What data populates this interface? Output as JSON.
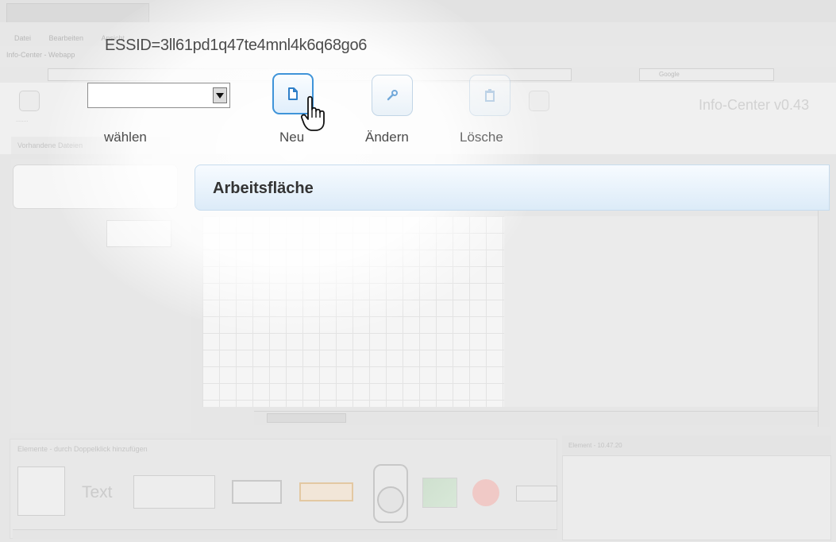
{
  "browser": {
    "menu_items": [
      "Datei",
      "Bearbeiten",
      "Ansicht"
    ],
    "tab_title": "Info-Center - Webapp",
    "session_text": "ESSID=3ll61pd1q47te4mnl4k6q68go6",
    "search_placeholder": "Google"
  },
  "toolbar": {
    "select_label": "wählen",
    "neu_label": "Neu",
    "aendern_label": "Ändern",
    "loeschen_label": "Lösche",
    "app_title": "Info-Center v0.43"
  },
  "left_panel": {
    "header": "Vorhandene Dateien"
  },
  "workspace": {
    "title": "Arbeitsfläche"
  },
  "palette": {
    "header": "Elemente - durch Doppelklick hinzufügen",
    "text_item": "Text"
  },
  "properties": {
    "header": "Element - 10.47.20"
  },
  "colors": {
    "accent": "#3f94d9",
    "header_gradient_top": "#f7fbff",
    "header_gradient_bottom": "#dcebf8"
  }
}
